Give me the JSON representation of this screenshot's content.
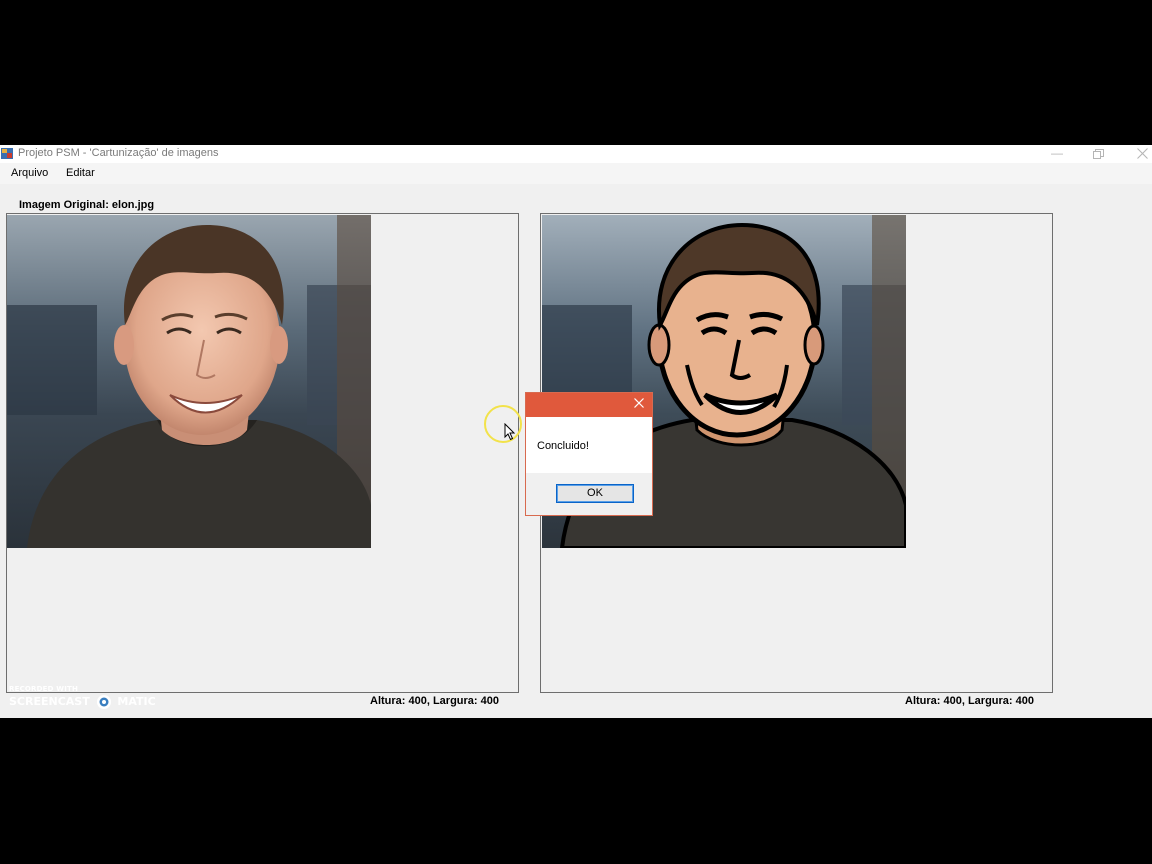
{
  "window": {
    "title": "Projeto PSM - 'Cartunização' de imagens",
    "icons": {
      "app": "app-icon",
      "minimize": "minimize-icon",
      "maximize": "maximize-icon",
      "close": "close-icon"
    }
  },
  "menu": {
    "items": [
      {
        "label": "Arquivo"
      },
      {
        "label": "Editar"
      }
    ]
  },
  "left_panel": {
    "caption": "Imagem Original: elon.jpg",
    "dimensions": "Altura: 400, Largura: 400",
    "image": "original-portrait-image"
  },
  "right_panel": {
    "dimensions": "Altura: 400, Largura: 400",
    "image": "cartoonized-portrait-image"
  },
  "dialog": {
    "message": "Concluido!",
    "ok_label": "OK",
    "title_color": "#e0593c"
  },
  "watermark": {
    "line1": "RECORDED WITH",
    "line2_left": "SCREENCAST",
    "line2_right": "MATIC"
  }
}
